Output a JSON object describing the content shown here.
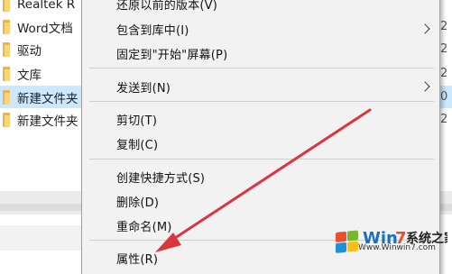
{
  "explorer": {
    "files": [
      {
        "name": "Realtek R",
        "date_fragment": "",
        "selected": false
      },
      {
        "name": "Word文档",
        "date_fragment": "2",
        "selected": false
      },
      {
        "name": "驱动",
        "date_fragment": "2",
        "selected": false
      },
      {
        "name": "文库",
        "date_fragment": "2",
        "selected": false
      },
      {
        "name": "新建文件夹",
        "date_fragment": "0",
        "selected": true
      },
      {
        "name": "新建文件夹",
        "date_fragment": "2",
        "selected": false
      }
    ]
  },
  "context_menu": {
    "items": [
      {
        "label": "还原以前的版本(V)",
        "submenu": false
      },
      {
        "label": "包含到库中(I)",
        "submenu": true
      },
      {
        "label": "固定到\"开始\"屏幕(P)",
        "submenu": false
      },
      {
        "label": "发送到(N)",
        "submenu": true
      },
      {
        "label": "剪切(T)",
        "submenu": false
      },
      {
        "label": "复制(C)",
        "submenu": false
      },
      {
        "label": "创建快捷方式(S)",
        "submenu": false
      },
      {
        "label": "删除(D)",
        "submenu": false
      },
      {
        "label": "重命名(M)",
        "submenu": false
      },
      {
        "label": "属性(R)",
        "submenu": false
      }
    ]
  },
  "annotation": {
    "color": "#d9363e"
  },
  "watermark": {
    "url_text": "Www.Winwin7.com"
  }
}
